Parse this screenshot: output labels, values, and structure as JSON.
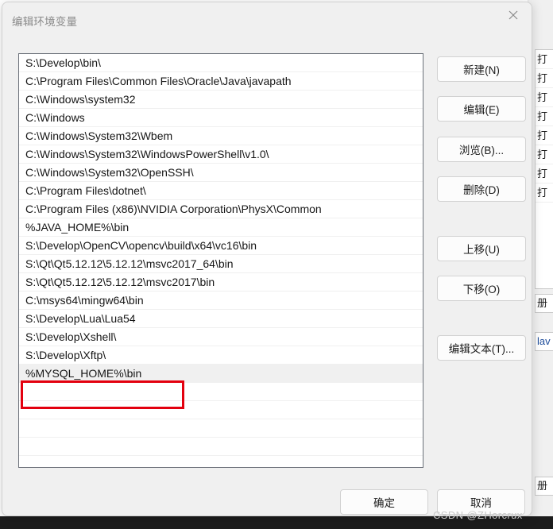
{
  "dialog": {
    "title": "编辑环境变量",
    "close_icon": "close-icon"
  },
  "path_list": {
    "entries": [
      "S:\\Develop\\bin\\",
      "C:\\Program Files\\Common Files\\Oracle\\Java\\javapath",
      "C:\\Windows\\system32",
      "C:\\Windows",
      "C:\\Windows\\System32\\Wbem",
      "C:\\Windows\\System32\\WindowsPowerShell\\v1.0\\",
      "C:\\Windows\\System32\\OpenSSH\\",
      "C:\\Program Files\\dotnet\\",
      "C:\\Program Files (x86)\\NVIDIA Corporation\\PhysX\\Common",
      "%JAVA_HOME%\\bin",
      "S:\\Develop\\OpenCV\\opencv\\build\\x64\\vc16\\bin",
      "S:\\Qt\\Qt5.12.12\\5.12.12\\msvc2017_64\\bin",
      "S:\\Qt\\Qt5.12.12\\5.12.12\\msvc2017\\bin",
      "C:\\msys64\\mingw64\\bin",
      "S:\\Develop\\Lua\\Lua54",
      "S:\\Develop\\Xshell\\",
      "S:\\Develop\\Xftp\\",
      "%MYSQL_HOME%\\bin",
      "",
      "",
      "",
      ""
    ],
    "selected_index": 17,
    "annotation_color": "#e3000f"
  },
  "side_buttons": {
    "new": "新建(N)",
    "edit": "编辑(E)",
    "browse": "浏览(B)...",
    "delete": "删除(D)",
    "move_up": "上移(U)",
    "move_down": "下移(O)",
    "edit_text": "编辑文本(T)..."
  },
  "bottom_buttons": {
    "ok": "确定",
    "cancel": "取消"
  },
  "watermark": {
    "text": "CSDN @ZHorcrux"
  },
  "background": {
    "list_rows": [
      "打",
      "打",
      "打",
      "打",
      "打",
      "打",
      "打",
      "打"
    ],
    "strip_1": "册",
    "strip_2": "lav",
    "strip_3": "册"
  }
}
